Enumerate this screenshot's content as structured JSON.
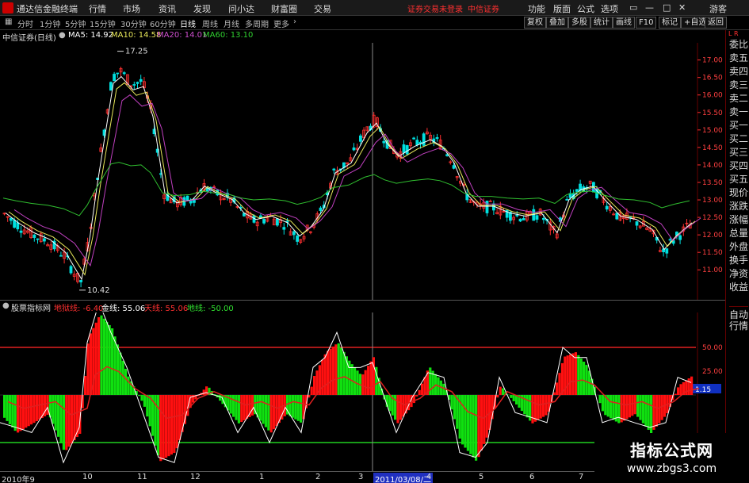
{
  "titlebar": {
    "app_title": "通达信金融终端",
    "menus": [
      "行情",
      "市场",
      "资讯",
      "发现",
      "问小达",
      "财富圈",
      "交易"
    ],
    "notice": "证券交易未登录",
    "broker": "中信证券",
    "right_buttons": [
      "功能",
      "版面",
      "公式",
      "选项"
    ],
    "guest": "游客"
  },
  "periods": [
    "分时",
    "1分钟",
    "5分钟",
    "15分钟",
    "30分钟",
    "60分钟",
    "日线",
    "周线",
    "月线",
    "多周期",
    "更多"
  ],
  "toolbar_right": [
    "复权",
    "叠加",
    "多股",
    "统计",
    "画线",
    "F10",
    "标记",
    "+自选",
    "返回"
  ],
  "info": {
    "stock": "中信证券(日线)",
    "ma5": "MA5: 14.92",
    "ma10": "MA10: 14.58",
    "ma20": "MA20: 14.01",
    "ma60": "MA60: 13.10"
  },
  "price_axis": [
    "17.00",
    "16.50",
    "16.00",
    "15.50",
    "15.00",
    "14.50",
    "14.00",
    "13.50",
    "13.00",
    "12.50",
    "12.00",
    "11.50",
    "11.00"
  ],
  "price_marks": {
    "high": "17.25",
    "low": "10.42"
  },
  "indicator": {
    "name": "股票指标网",
    "label1": "地狱线: -6.40",
    "label2": "金线: 55.06",
    "label3": "天线: 55.06",
    "label4": "地线: -50.00"
  },
  "ind_axis": [
    "50.00",
    "25.00",
    "1.15"
  ],
  "dates": [
    "2010年9",
    "10",
    "11",
    "12",
    "1",
    "2",
    "3",
    "2011/03/08/二",
    "4",
    "5",
    "6",
    "7"
  ],
  "sidebar": {
    "corner": "L R",
    "items": [
      "委比",
      "卖五",
      "卖四",
      "卖三",
      "卖二",
      "卖一",
      "买一",
      "买二",
      "买三",
      "买四",
      "买五",
      "现价",
      "涨跌",
      "涨幅",
      "总量",
      "外盘",
      "换手",
      "净资",
      "收益"
    ],
    "bottom": [
      "自动",
      "行情"
    ]
  },
  "watermark": {
    "line1": "指标公式网",
    "line2": "www.zbgs3.com"
  },
  "colors": {
    "up": "#ff3030",
    "down": "#00e0e0",
    "ma5": "#ffffff",
    "ma10": "#e8e85a",
    "ma20": "#c040c0",
    "ma60": "#30c030",
    "bar_up": "#ff1010",
    "bar_down": "#10e010"
  }
}
